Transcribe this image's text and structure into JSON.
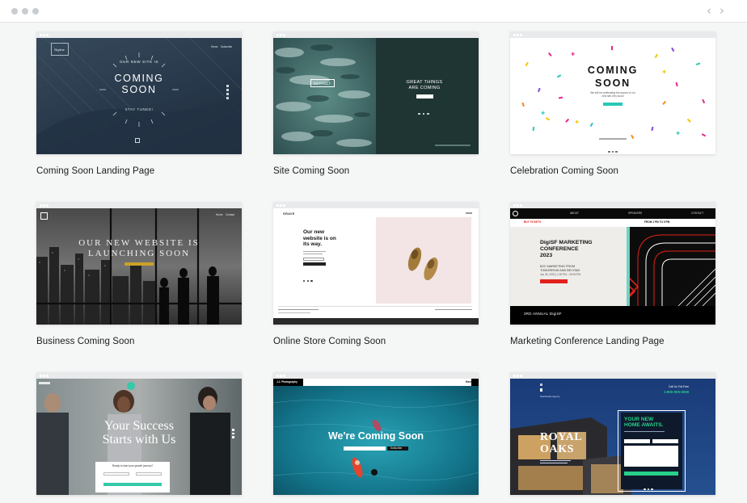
{
  "window": {
    "back_icon": "chevron-left-icon",
    "forward_icon": "chevron-right-icon"
  },
  "templates": [
    {
      "caption": "Coming Soon Landing Page",
      "preview": {
        "logo": "Skyline",
        "nav": [
          "Home",
          "Subscribe"
        ],
        "kicker": "OUR NEW SITE IS",
        "heading_line1": "COMING",
        "heading_line2": "SOON",
        "tagline": "STAY TUNED!",
        "bg": "#2d3e4f"
      }
    },
    {
      "caption": "Site Coming Soon",
      "preview": {
        "logo": "DEFAULT",
        "headline_line1": "GREAT THINGS",
        "headline_line2": "ARE COMING",
        "bg": "#1f3533"
      }
    },
    {
      "caption": "Celebration Coming Soon",
      "preview": {
        "heading_line1": "COMING",
        "heading_line2": "SOON",
        "subtext": "We will be celebrating the launch of our new site very soon!",
        "accent": "#25c9b6"
      }
    },
    {
      "caption": "Business Coming Soon",
      "preview": {
        "nav": [
          "Home",
          "Contact"
        ],
        "heading_line1": "OUR NEW WEBSITE IS",
        "heading_line2": "LAUNCHING SOON",
        "accent": "#c9a227"
      }
    },
    {
      "caption": "Online Store Coming Soon",
      "preview": {
        "logo": "GRAVE",
        "heading_line1": "Our new",
        "heading_line2": "website is on",
        "heading_line3": "its way.",
        "photo_bg": "#f3e4e6"
      }
    },
    {
      "caption": "Marketing Conference Landing Page",
      "preview": {
        "cta": "BUY TICKETS",
        "nav": [
          "ABOUT",
          "SPEAKERS",
          "CONTACT"
        ],
        "date_line": "FROM 1 PM TO 5 PM",
        "title_line1": "DigiSF MARKETING",
        "title_line2": "CONFERENCE",
        "title_line3": "2023",
        "sub_line1": "B2C MARKETING FROM",
        "sub_line2": "TOMORROW AND BEYOND",
        "date": "Jun 26, 2023 | 1:00 PM – 05:00 PM",
        "footer": "3RD ANNUAL DigiSF",
        "accent": "#e2211c"
      }
    },
    {
      "caption": "",
      "preview": {
        "heading_line1": "Your Success",
        "heading_line2": "Starts with Us",
        "form_title": "Ready to start your growth journey?",
        "accent": "#35c9a8"
      }
    },
    {
      "caption": "",
      "preview": {
        "brand": "J.J. Photography",
        "nav": "Home",
        "heading": "We're Coming Soon",
        "button": "Subscribe",
        "bg": "#0f6b7e"
      }
    },
    {
      "caption": "",
      "preview": {
        "agency": "Real Estate Agency",
        "phone_label": "Call Us Toll-Free",
        "phone": "1-800-000-0000",
        "heading_line1": "YOUR NEW",
        "heading_line2": "HOME AWAITS.",
        "project_line1": "ROYAL",
        "project_line2": "OAKS",
        "accent": "#27d08a"
      }
    }
  ]
}
